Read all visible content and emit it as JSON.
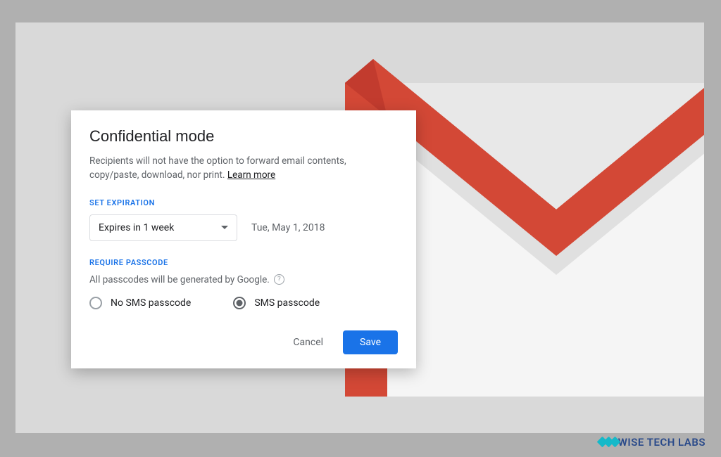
{
  "dialog": {
    "title": "Confidential mode",
    "description": "Recipients will not have the option to forward email contents, copy/paste, download, nor print. ",
    "learn_more": "Learn more",
    "expiration": {
      "label": "SET EXPIRATION",
      "selected": "Expires in 1 week",
      "date": "Tue, May 1, 2018"
    },
    "passcode": {
      "label": "REQUIRE PASSCODE",
      "hint": "All passcodes will be generated by Google.",
      "options": {
        "no_sms": "No SMS passcode",
        "sms": "SMS passcode"
      },
      "selected": "sms"
    },
    "buttons": {
      "cancel": "Cancel",
      "save": "Save"
    }
  },
  "watermark": {
    "text": "WISE TECH LABS"
  }
}
